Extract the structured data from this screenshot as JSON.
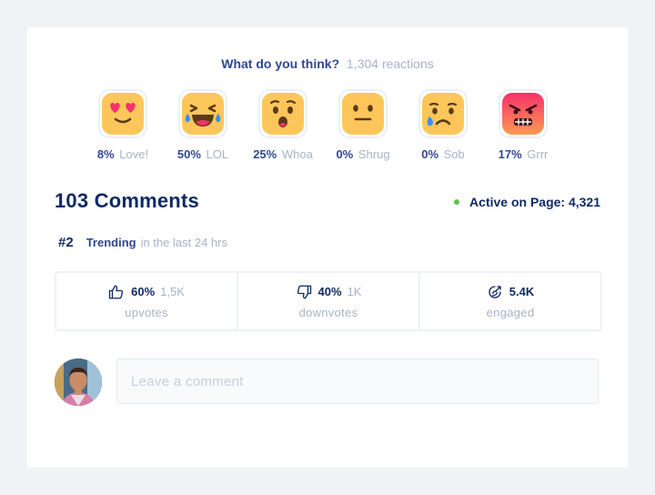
{
  "question": {
    "text": "What do you think?",
    "count": "1,304 reactions"
  },
  "reactions": [
    {
      "pct": "8%",
      "name": "Love!",
      "icon": "heart-eyes-emoji-icon"
    },
    {
      "pct": "50%",
      "name": "LOL",
      "icon": "laughing-tears-emoji-icon"
    },
    {
      "pct": "25%",
      "name": "Whoa",
      "icon": "surprised-emoji-icon"
    },
    {
      "pct": "0%",
      "name": "Shrug",
      "icon": "neutral-face-emoji-icon"
    },
    {
      "pct": "0%",
      "name": "Sob",
      "icon": "crying-emoji-icon"
    },
    {
      "pct": "17%",
      "name": "Grrr",
      "icon": "angry-emoji-icon"
    }
  ],
  "comments": {
    "title": "103 Comments",
    "active": "Active on Page: 4,321"
  },
  "trending": {
    "rank": "#2",
    "label": "Trending",
    "sub": "in the last 24 hrs"
  },
  "stats": [
    {
      "value": "60%",
      "count": "1,5K",
      "label": "upvotes",
      "icon": "thumbs-up-icon"
    },
    {
      "value": "40%",
      "count": "1K",
      "label": "downvotes",
      "icon": "thumbs-down-icon"
    },
    {
      "value": "5.4K",
      "count": "",
      "label": "engaged",
      "icon": "engagement-icon"
    }
  ],
  "comment_box": {
    "placeholder": "Leave a comment"
  },
  "colors": {
    "accent": "#2f4892",
    "heading": "#0f2a64",
    "muted": "#a8b2c6",
    "active_dot": "#62c24a",
    "emoji_yellow": "#fdc65a",
    "emoji_angry": "#f5316a"
  }
}
